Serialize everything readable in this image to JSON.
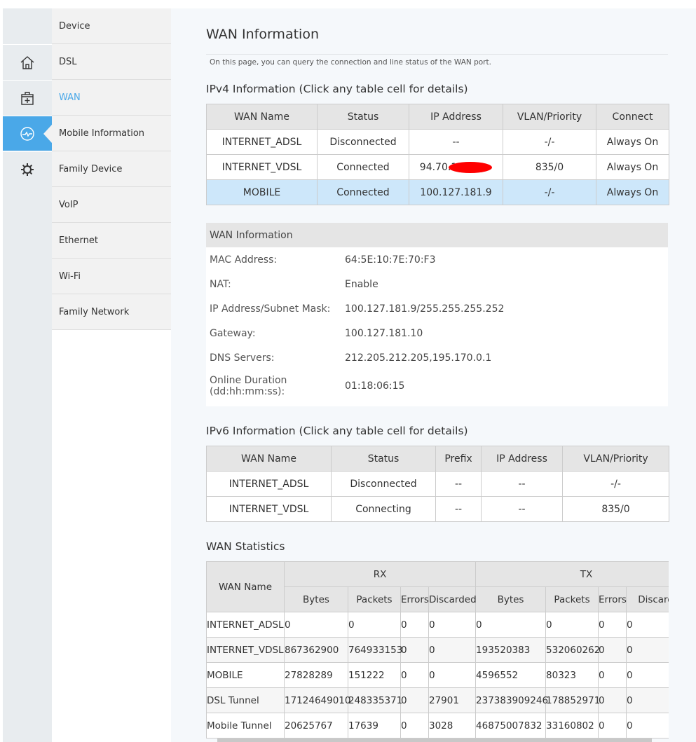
{
  "nav": {
    "rail": [
      {
        "icon": "home-icon"
      },
      {
        "icon": "medical-kit-icon"
      },
      {
        "icon": "pulse-icon",
        "active": true
      },
      {
        "icon": "gear-icon"
      }
    ],
    "items": [
      "Device",
      "DSL",
      "WAN",
      "Mobile Information",
      "Family Device",
      "VoIP",
      "Ethernet",
      "Wi-Fi",
      "Family Network"
    ],
    "selected": "WAN"
  },
  "page": {
    "title": "WAN Information",
    "description": "On this page, you can query the connection and line status of the WAN port."
  },
  "ipv4": {
    "title": "IPv4 Information (Click any table cell for details)",
    "headers": [
      "WAN Name",
      "Status",
      "IP Address",
      "VLAN/Priority",
      "Connect"
    ],
    "rows": [
      [
        "INTERNET_ADSL",
        "Disconnected",
        "--",
        "-/-",
        "Always On"
      ],
      [
        "INTERNET_VDSL",
        "Connected",
        "94.70.1",
        "835/0",
        "Always On"
      ],
      [
        "MOBILE",
        "Connected",
        "100.127.181.9",
        "-/-",
        "Always On"
      ]
    ]
  },
  "wan_info": {
    "title": "WAN Information",
    "rows": [
      {
        "label": "MAC Address:",
        "value": "64:5E:10:7E:70:F3"
      },
      {
        "label": "NAT:",
        "value": "Enable"
      },
      {
        "label": "IP Address/Subnet Mask:",
        "value": "100.127.181.9/255.255.255.252"
      },
      {
        "label": "Gateway:",
        "value": "100.127.181.10"
      },
      {
        "label": "DNS Servers:",
        "value": "212.205.212.205,195.170.0.1"
      },
      {
        "label": "Online Duration (dd:hh:mm:ss):",
        "value": "01:18:06:15"
      }
    ]
  },
  "ipv6": {
    "title": "IPv6 Information (Click any table cell for details)",
    "headers": [
      "WAN Name",
      "Status",
      "Prefix",
      "IP Address",
      "VLAN/Priority"
    ],
    "rows": [
      [
        "INTERNET_ADSL",
        "Disconnected",
        "--",
        "--",
        "-/-"
      ],
      [
        "INTERNET_VDSL",
        "Connecting",
        "--",
        "--",
        "835/0"
      ]
    ]
  },
  "stats": {
    "title": "WAN Statistics",
    "name_header": "WAN Name",
    "rx": "RX",
    "tx": "TX",
    "sub_headers": [
      "Bytes",
      "Packets",
      "Errors",
      "Discarded",
      "Bytes",
      "Packets",
      "Errors",
      "Discarded"
    ],
    "rows": [
      [
        "INTERNET_ADSL",
        "0",
        "0",
        "0",
        "0",
        "0",
        "0",
        "0",
        "0"
      ],
      [
        "INTERNET_VDSL",
        "867362900",
        "764933153",
        "0",
        "0",
        "193520383",
        "532060262",
        "0",
        "0"
      ],
      [
        "MOBILE",
        "27828289",
        "151222",
        "0",
        "0",
        "4596552",
        "80323",
        "0",
        "0"
      ],
      [
        "DSL Tunnel",
        "17124649010",
        "248335371",
        "0",
        "27901",
        "237383909246",
        "178852971",
        "0",
        "0"
      ],
      [
        "Mobile Tunnel",
        "20625767",
        "17639",
        "0",
        "3028",
        "46875007832",
        "33160802",
        "0",
        "0"
      ]
    ]
  }
}
